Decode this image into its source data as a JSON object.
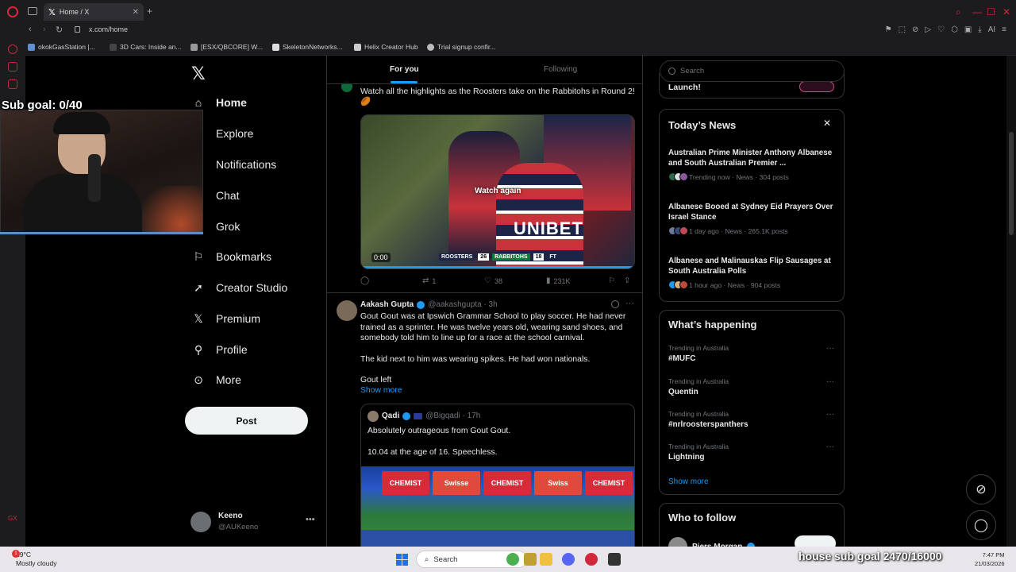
{
  "browser": {
    "tab_title": "Home / X",
    "url": "x.com/home",
    "bookmarks": [
      "okokGasStation |...",
      "3D Cars: Inside an...",
      "[ESX/QBCORE] W...",
      "SkeletonNetworks...",
      "Helix Creator Hub",
      "Trial signup confir..."
    ],
    "ai_label": "AI"
  },
  "stream": {
    "sub_goal": "Sub goal: 0/40",
    "house_goal": "house sub goal 2470/16000"
  },
  "nav": {
    "items": [
      {
        "label": "Home",
        "icon": "home-icon"
      },
      {
        "label": "Explore",
        "icon": "search-icon"
      },
      {
        "label": "Notifications",
        "icon": "bell-icon"
      },
      {
        "label": "Chat",
        "icon": "chat-icon"
      },
      {
        "label": "Grok",
        "icon": "grok-icon"
      },
      {
        "label": "Bookmarks",
        "icon": "bookmark-icon"
      },
      {
        "label": "Creator Studio",
        "icon": "rocket-icon"
      },
      {
        "label": "Premium",
        "icon": "x-icon"
      },
      {
        "label": "Profile",
        "icon": "person-icon"
      },
      {
        "label": "More",
        "icon": "more-circle-icon"
      }
    ],
    "post_label": "Post",
    "account": {
      "name": "Keeno",
      "handle": "@AUKeeno"
    }
  },
  "timeline": {
    "tabs": [
      "For you",
      "Following"
    ],
    "tweet1": {
      "text": "Watch all the highlights as the Roosters take on the Rabbitohs in Round 2! 🏉",
      "video": {
        "overlay": "Watch again",
        "time": "0:00",
        "score": {
          "home": "ROOSTERS",
          "home_score": "26",
          "away": "RABBITOHS",
          "away_score": "18",
          "status": "FT"
        },
        "jersey": "UNIBET"
      },
      "stats": {
        "retweets": "1",
        "likes": "38",
        "views": "231K"
      }
    },
    "tweet2": {
      "name": "Aakash Gupta",
      "handle": "@aakashgupta · 3h",
      "paragraphs": [
        "Gout Gout was at Ipswich Grammar School to play soccer. He had never trained as a sprinter. He was twelve years old, wearing sand shoes, and somebody told him to line up for a race at the school carnival.",
        "The kid next to him was wearing spikes. He had won nationals.",
        "Gout left"
      ],
      "show_more": "Show more",
      "quote": {
        "name": "Qadi",
        "handle": "@Bigqadi · 17h",
        "text1": "Absolutely outrageous from Gout Gout.",
        "text2": "10.04 at the age of 16. Speechless.",
        "banners": [
          "CHEMIST",
          "Swisse",
          "CHEMIST",
          "Swiss",
          "CHEMIST"
        ]
      }
    }
  },
  "sidebar": {
    "search_placeholder": "Search",
    "promo_text": "Launch!",
    "news_title": "Today’s News",
    "news": [
      {
        "title": "Australian Prime Minister Anthony Albanese and South Australian Premier ...",
        "meta": "Trending now · News · 304 posts"
      },
      {
        "title": "Albanese Booed at Sydney Eid Prayers Over Israel Stance",
        "meta": "1 day ago · News · 265.1K posts"
      },
      {
        "title": "Albanese and Malinauskas Flip Sausages at South Australia Polls",
        "meta": "1 hour ago · News · 904 posts"
      }
    ],
    "happening_title": "What’s happening",
    "trends": [
      {
        "category": "Trending in Australia",
        "topic": "#MUFC"
      },
      {
        "category": "Trending in Australia",
        "topic": "Quentin"
      },
      {
        "category": "Trending in Australia",
        "topic": "#nrlroosterspanthers"
      },
      {
        "category": "Trending in Australia",
        "topic": "Lightning"
      }
    ],
    "show_more": "Show more",
    "who_to_follow_title": "Who to follow",
    "follow_suggestion": "Piers Morgan"
  },
  "taskbar": {
    "weather_temp": "19°C",
    "weather_desc": "Mostly cloudy",
    "search_label": "Search",
    "time": "7:47 PM",
    "date": "21/03/2026"
  },
  "colors": {
    "accent": "#1d9bf0",
    "opera_red": "#d1283b"
  }
}
